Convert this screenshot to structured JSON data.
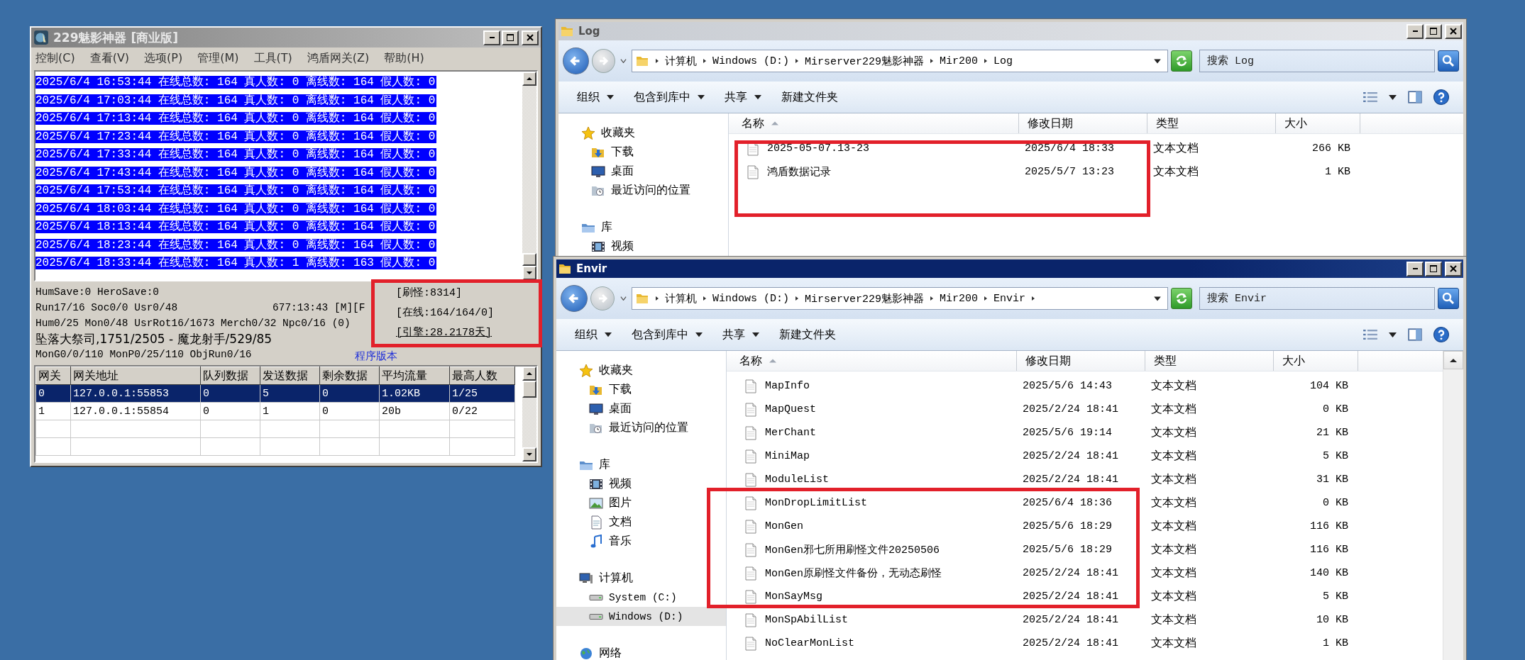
{
  "server_window": {
    "title": "229魅影神器 [商业版]",
    "active": false,
    "menu": [
      "控制(C)",
      "查看(V)",
      "选项(P)",
      "管理(M)",
      "工具(T)",
      "鸿盾网关(Z)",
      "帮助(H)"
    ],
    "log_lines": [
      {
        "text": "2025/6/4 16:53:44 在线总数: 164 真人数: 0 离线数: 164 假人数: 0",
        "selected": true
      },
      {
        "text": "2025/6/4 17:03:44 在线总数: 164 真人数: 0 离线数: 164 假人数: 0",
        "selected": true
      },
      {
        "text": "2025/6/4 17:13:44 在线总数: 164 真人数: 0 离线数: 164 假人数: 0",
        "selected": true
      },
      {
        "text": "2025/6/4 17:23:44 在线总数: 164 真人数: 0 离线数: 164 假人数: 0",
        "selected": true
      },
      {
        "text": "2025/6/4 17:33:44 在线总数: 164 真人数: 0 离线数: 164 假人数: 0",
        "selected": true
      },
      {
        "text": "2025/6/4 17:43:44 在线总数: 164 真人数: 0 离线数: 164 假人数: 0",
        "selected": true
      },
      {
        "text": "2025/6/4 17:53:44 在线总数: 164 真人数: 0 离线数: 164 假人数: 0",
        "selected": true
      },
      {
        "text": "2025/6/4 18:03:44 在线总数: 164 真人数: 0 离线数: 164 假人数: 0",
        "selected": true
      },
      {
        "text": "2025/6/4 18:13:44 在线总数: 164 真人数: 0 离线数: 164 假人数: 0",
        "selected": true
      },
      {
        "text": "2025/6/4 18:23:44 在线总数: 164 真人数: 0 离线数: 164 假人数: 0",
        "selected": true
      },
      {
        "text": "2025/6/4 18:33:44 在线总数: 164 真人数: 1 离线数: 163 假人数: 0",
        "selected": true
      }
    ],
    "status_lines": [
      {
        "text": "HumSave:0 HeroSave:0",
        "kind": "mono"
      },
      {
        "text": "Run17/16 Soc0/0 Usr0/48",
        "kind": "mono",
        "aside": {
          "text": "677:13:43 [M][F",
          "kind": "uptime"
        }
      },
      {
        "text": "Hum0/25 Mon0/48 UsrRot16/1673 Merch0/32 Npc0/16 (0)",
        "kind": "mono"
      },
      {
        "text": "坠落大祭司,1751/2505 - 魔龙射手/529/85",
        "kind": "large"
      },
      {
        "text": "MonG0/0/110 MonP0/25/110 ObjRun0/16",
        "kind": "mono",
        "aside": {
          "text": "程序版本",
          "kind": "version"
        }
      }
    ],
    "counters": [
      {
        "text": "[刷怪:8314]",
        "kind": "text"
      },
      {
        "text": "[在线:164/164/0]",
        "kind": "text"
      },
      {
        "text": "[引擎:28.2178天]",
        "kind": "link"
      }
    ],
    "gateways": {
      "columns": [
        "网关",
        "网关地址",
        "队列数据",
        "发送数据",
        "剩余数据",
        "平均流量",
        "最高人数"
      ],
      "rows": [
        {
          "cells": [
            "0",
            "127.0.0.1:55853",
            "0",
            "5",
            "0",
            "1.02KB",
            "1/25"
          ],
          "selected": true
        },
        {
          "cells": [
            "1",
            "127.0.0.1:55854",
            "0",
            "1",
            "0",
            "20b",
            "0/22"
          ],
          "selected": false
        }
      ]
    }
  },
  "explorers": [
    {
      "title": "Log",
      "active": false,
      "path": [
        "计算机",
        "Windows (D:)",
        "Mirserver229魅影神器",
        "Mir200",
        "Log"
      ],
      "trailing_arrow": false,
      "search_placeholder": "搜索 Log",
      "toolbar": [
        {
          "label": "组织",
          "dropdown": true
        },
        {
          "label": "包含到库中",
          "dropdown": true
        },
        {
          "label": "共享",
          "dropdown": true
        },
        {
          "label": "新建文件夹",
          "dropdown": false
        }
      ],
      "nav": [
        {
          "label": "收藏夹",
          "kind": "favorites",
          "selected": false,
          "children": [
            {
              "label": "下载",
              "kind": "downloads",
              "selected": false
            },
            {
              "label": "桌面",
              "kind": "desktop",
              "selected": false
            },
            {
              "label": "最近访问的位置",
              "kind": "recent",
              "selected": false
            }
          ]
        },
        {
          "label": "库",
          "kind": "libraries",
          "selected": false,
          "children": [
            {
              "label": "视频",
              "kind": "videos",
              "selected": false
            }
          ]
        }
      ],
      "columns": [
        {
          "label": "名称",
          "sorted": true
        },
        {
          "label": "修改日期",
          "sorted": false
        },
        {
          "label": "类型",
          "sorted": false
        },
        {
          "label": "大小",
          "sorted": false
        }
      ],
      "files": [
        {
          "name": "2025-05-07.13-23",
          "modified": "2025/6/4 18:33",
          "type": "文本文档",
          "size": "266 KB",
          "selected": false
        },
        {
          "name": "鸿盾数据记录",
          "modified": "2025/5/7 13:23",
          "type": "文本文档",
          "size": "1 KB",
          "selected": false
        }
      ]
    },
    {
      "title": "Envir",
      "active": true,
      "path": [
        "计算机",
        "Windows (D:)",
        "Mirserver229魅影神器",
        "Mir200",
        "Envir"
      ],
      "trailing_arrow": true,
      "search_placeholder": "搜索 Envir",
      "toolbar": [
        {
          "label": "组织",
          "dropdown": true
        },
        {
          "label": "包含到库中",
          "dropdown": true
        },
        {
          "label": "共享",
          "dropdown": true
        },
        {
          "label": "新建文件夹",
          "dropdown": false
        }
      ],
      "nav": [
        {
          "label": "收藏夹",
          "kind": "favorites",
          "selected": false,
          "children": [
            {
              "label": "下载",
              "kind": "downloads",
              "selected": false
            },
            {
              "label": "桌面",
              "kind": "desktop",
              "selected": false
            },
            {
              "label": "最近访问的位置",
              "kind": "recent",
              "selected": false
            }
          ]
        },
        {
          "label": "库",
          "kind": "libraries",
          "selected": false,
          "children": [
            {
              "label": "视频",
              "kind": "videos",
              "selected": false
            },
            {
              "label": "图片",
              "kind": "pictures",
              "selected": false
            },
            {
              "label": "文档",
              "kind": "documents",
              "selected": false
            },
            {
              "label": "音乐",
              "kind": "music",
              "selected": false
            }
          ]
        },
        {
          "label": "计算机",
          "kind": "computer",
          "selected": false,
          "children": [
            {
              "label": "System (C:)",
              "kind": "drive",
              "selected": false
            },
            {
              "label": "Windows (D:)",
              "kind": "drive",
              "selected": true
            }
          ]
        },
        {
          "label": "网络",
          "kind": "network",
          "selected": false
        }
      ],
      "columns": [
        {
          "label": "名称",
          "sorted": true
        },
        {
          "label": "修改日期",
          "sorted": false
        },
        {
          "label": "类型",
          "sorted": false
        },
        {
          "label": "大小",
          "sorted": false
        }
      ],
      "files": [
        {
          "name": "MapInfo",
          "modified": "2025/5/6 14:43",
          "type": "文本文档",
          "size": "104 KB",
          "selected": false
        },
        {
          "name": "MapQuest",
          "modified": "2025/2/24 18:41",
          "type": "文本文档",
          "size": "0 KB",
          "selected": false
        },
        {
          "name": "MerChant",
          "modified": "2025/5/6 19:14",
          "type": "文本文档",
          "size": "21 KB",
          "selected": false
        },
        {
          "name": "MiniMap",
          "modified": "2025/2/24 18:41",
          "type": "文本文档",
          "size": "5 KB",
          "selected": false
        },
        {
          "name": "ModuleList",
          "modified": "2025/2/24 18:41",
          "type": "文本文档",
          "size": "31 KB",
          "selected": false
        },
        {
          "name": "MonDropLimitList",
          "modified": "2025/6/4 18:36",
          "type": "文本文档",
          "size": "0 KB",
          "selected": false
        },
        {
          "name": "MonGen",
          "modified": "2025/5/6 18:29",
          "type": "文本文档",
          "size": "116 KB",
          "selected": false
        },
        {
          "name": "MonGen邪七所用刷怪文件20250506",
          "modified": "2025/5/6 18:29",
          "type": "文本文档",
          "size": "116 KB",
          "selected": false
        },
        {
          "name": "MonGen原刷怪文件备份，无动态刷怪",
          "modified": "2025/2/24 18:41",
          "type": "文本文档",
          "size": "140 KB",
          "selected": false
        },
        {
          "name": "MonSayMsg",
          "modified": "2025/2/24 18:41",
          "type": "文本文档",
          "size": "5 KB",
          "selected": false
        },
        {
          "name": "MonSpAbilList",
          "modified": "2025/2/24 18:41",
          "type": "文本文档",
          "size": "10 KB",
          "selected": false
        },
        {
          "name": "NoClearMonList",
          "modified": "2025/2/24 18:41",
          "type": "文本文档",
          "size": "1 KB",
          "selected": false
        }
      ]
    }
  ]
}
